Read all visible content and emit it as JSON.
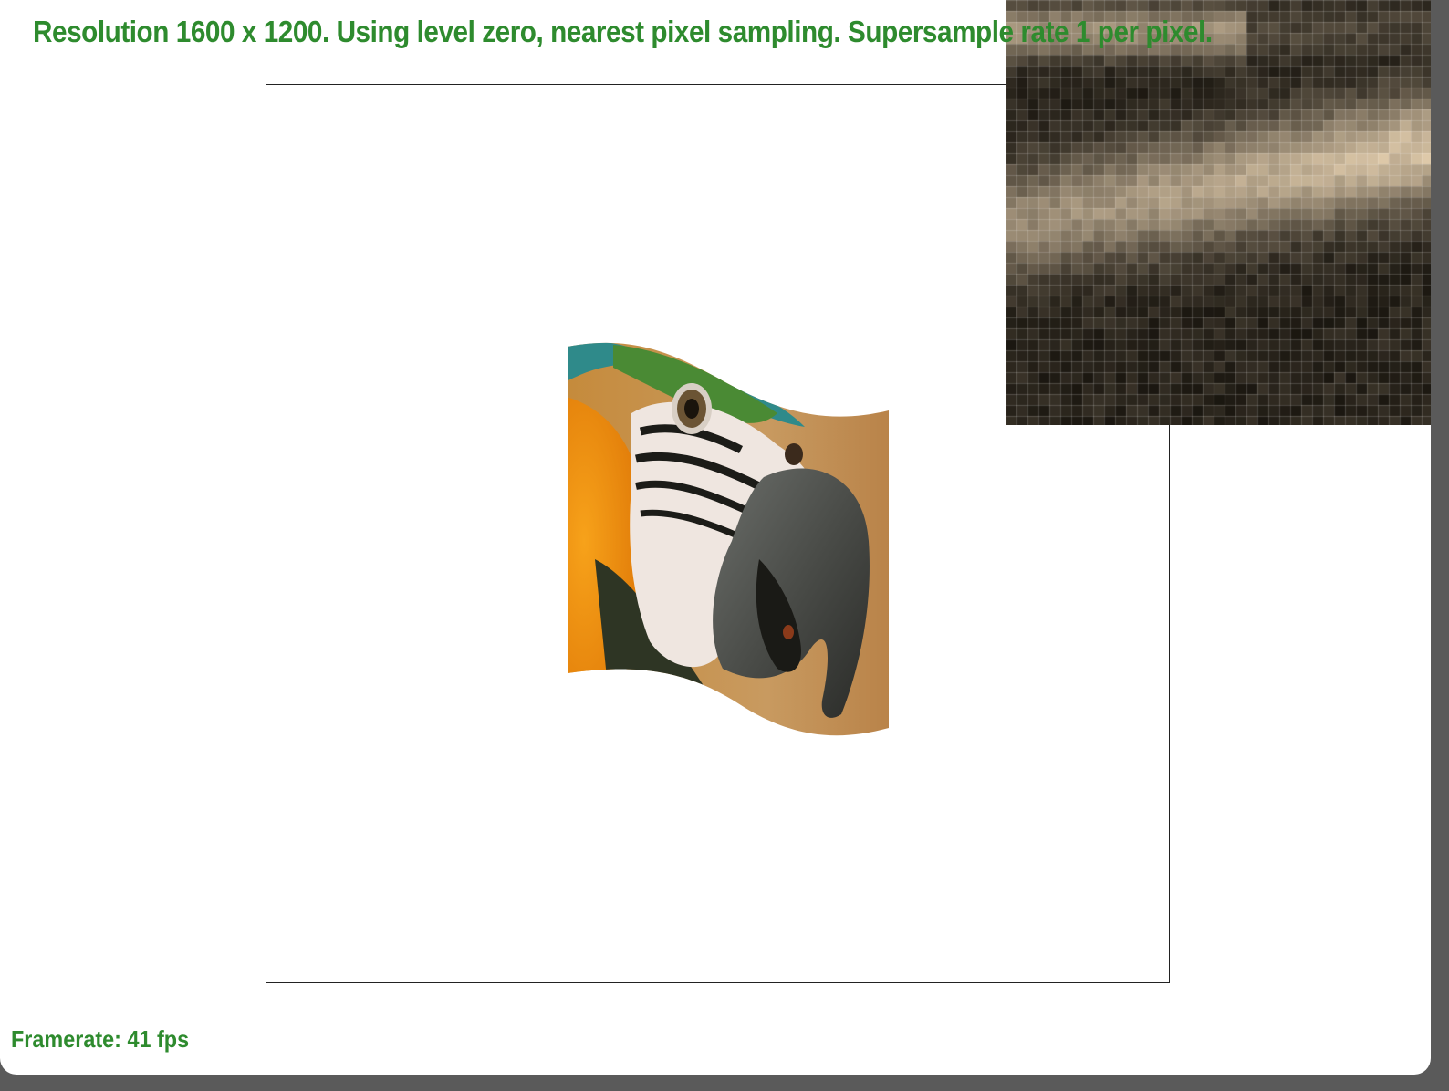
{
  "app": {
    "status_text": "Resolution 1600 x 1200. Using level zero, nearest pixel sampling. Supersample rate 1 per pixel.",
    "framerate_text": "Framerate: 41 fps"
  },
  "colors": {
    "overlay_text": "#2e8b2e",
    "background": "#ffffff",
    "viewport_border": "#222222"
  },
  "scene": {
    "textured_object": "parrot-macaw-texture",
    "warp": "sine-wave"
  },
  "zoom_view": {
    "description_icon": "pixel-magnifier-icon"
  }
}
